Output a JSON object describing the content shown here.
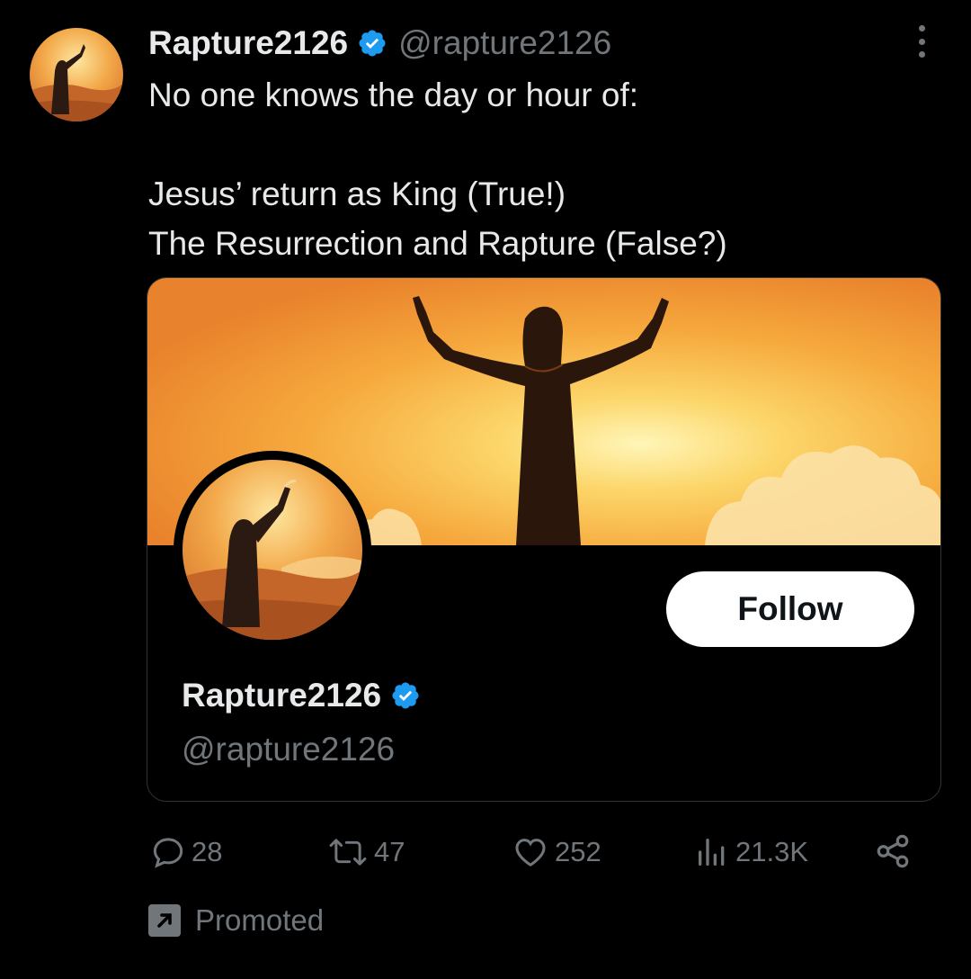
{
  "tweet": {
    "display_name": "Rapture2126",
    "handle": "@rapture2126",
    "lines": [
      "No one knows the day or hour of:",
      "",
      "Jesus’ return as King (True!)",
      "The Resurrection and Rapture (False?)"
    ]
  },
  "card": {
    "follow_label": "Follow",
    "display_name": "Rapture2126",
    "handle": "@rapture2126"
  },
  "actions": {
    "replies": "28",
    "reposts": "47",
    "likes": "252",
    "views": "21.3K"
  },
  "promoted_label": "Promoted",
  "colors": {
    "background": "#000000",
    "text": "#e7e9ea",
    "muted": "#71767b",
    "verified": "#1d9bf0",
    "border": "#2f3336"
  },
  "icons": [
    "verified-badge-icon",
    "more-options-icon",
    "reply-icon",
    "repost-icon",
    "like-icon",
    "views-icon",
    "share-icon",
    "promoted-icon"
  ]
}
